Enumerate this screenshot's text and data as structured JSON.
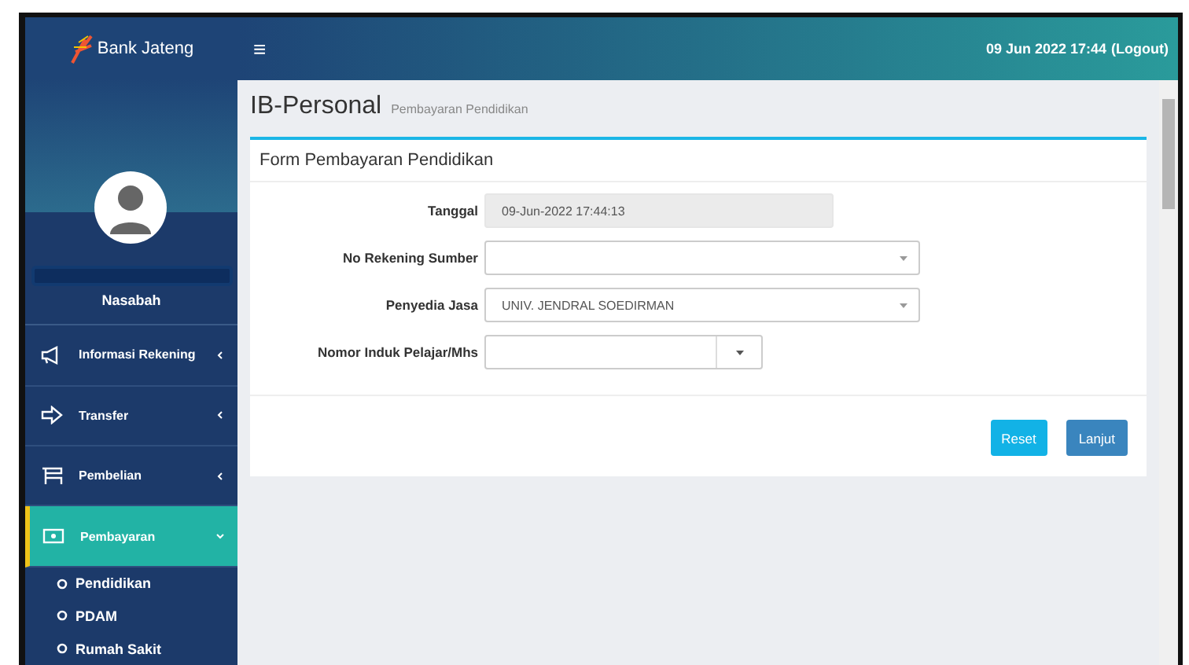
{
  "sidebar": {
    "logo_text": "Bank Jateng",
    "user": {
      "role": "Nasabah"
    },
    "menu": [
      {
        "label": "Informasi Rekening",
        "selected": false,
        "expanded": false
      },
      {
        "label": "Transfer",
        "selected": false,
        "expanded": false
      },
      {
        "label": "Pembelian",
        "selected": false,
        "expanded": false
      },
      {
        "label": "Pembayaran",
        "selected": true,
        "expanded": true,
        "children": [
          {
            "label": "Pendidikan"
          },
          {
            "label": "PDAM"
          },
          {
            "label": "Rumah Sakit"
          }
        ]
      }
    ]
  },
  "topbar": {
    "menu_glyph": "≡",
    "datetime": "09 Jun 2022 17:44",
    "logout": "(Logout)"
  },
  "page": {
    "title": "IB-Personal",
    "subtitle": "Pembayaran Pendidikan"
  },
  "form": {
    "title": "Form Pembayaran Pendidikan",
    "fields": [
      {
        "kind": "readonly",
        "label": "Tanggal",
        "value": "09-Jun-2022 17:44:13"
      },
      {
        "kind": "select",
        "label": "No Rekening Sumber"
      },
      {
        "kind": "select",
        "label": "Penyedia Jasa",
        "value": "UNIV. JENDRAL SOEDIRMAN"
      },
      {
        "kind": "combo",
        "label": "Nomor Induk Pelajar/Mhs"
      }
    ],
    "buttons": [
      {
        "kind": "reset",
        "label": "Reset"
      },
      {
        "kind": "submit",
        "label": "Lanjut"
      }
    ]
  }
}
